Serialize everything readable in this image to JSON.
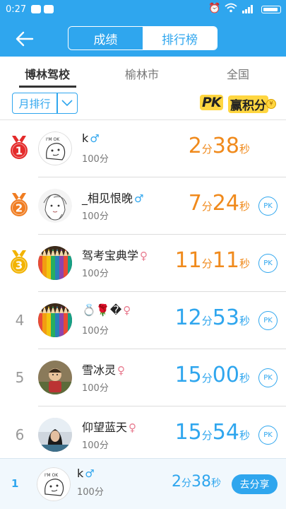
{
  "statusbar": {
    "time": "0:27"
  },
  "header": {
    "tabs": [
      {
        "label": "成绩",
        "active": true
      },
      {
        "label": "排行榜",
        "active": false
      }
    ]
  },
  "region_tabs": [
    {
      "label": "博林驾校",
      "active": true
    },
    {
      "label": "榆林市",
      "active": false
    },
    {
      "label": "全国",
      "active": false
    }
  ],
  "filter": {
    "label": "月排行"
  },
  "pk_banner": {
    "pk": "PK",
    "text": "赢积分",
    "coin": "¥"
  },
  "colors": {
    "primary": "#2fa6ee",
    "orange": "#f08a1c",
    "gold": "#f2b300",
    "red": "#e42b2b",
    "bronze": "#f07d22"
  },
  "units": {
    "minute": "分",
    "second": "秒"
  },
  "list": [
    {
      "rank": "1",
      "medal": "gold-red",
      "name": "k",
      "gender": "♂",
      "gender_type": "male",
      "score": "100分",
      "min": "2",
      "sec": "38",
      "color": "orange",
      "pk": "",
      "avatar": "cartoon-ok"
    },
    {
      "rank": "2",
      "medal": "bronze",
      "name": "_相见恨晚",
      "gender": "♂",
      "gender_type": "male",
      "score": "100分",
      "min": "7",
      "sec": "24",
      "color": "orange",
      "pk": "PK",
      "avatar": "sketch-girl"
    },
    {
      "rank": "3",
      "medal": "gold",
      "name": "驾考宝典学",
      "gender": "♀",
      "gender_type": "female",
      "score": "100分",
      "min": "11",
      "sec": "11",
      "color": "orange",
      "pk": "PK",
      "avatar": "pencils"
    },
    {
      "rank": "4",
      "medal": "",
      "name": "💍🌹�",
      "gender": "♀",
      "gender_type": "female",
      "score": "100分",
      "min": "12",
      "sec": "53",
      "color": "blue",
      "pk": "PK",
      "avatar": "pencils"
    },
    {
      "rank": "5",
      "medal": "",
      "name": "雪冰灵",
      "gender": "♀",
      "gender_type": "female",
      "score": "100分",
      "min": "15",
      "sec": "00",
      "color": "blue",
      "pk": "PK",
      "avatar": "child"
    },
    {
      "rank": "6",
      "medal": "",
      "name": "仰望蓝天",
      "gender": "♀",
      "gender_type": "female",
      "score": "100分",
      "min": "15",
      "sec": "54",
      "color": "blue",
      "pk": "PK",
      "avatar": "portrait"
    }
  ],
  "me": {
    "rank": "1",
    "name": "k",
    "gender": "♂",
    "score": "100分",
    "min": "2",
    "sec": "38",
    "share": "去分享"
  }
}
